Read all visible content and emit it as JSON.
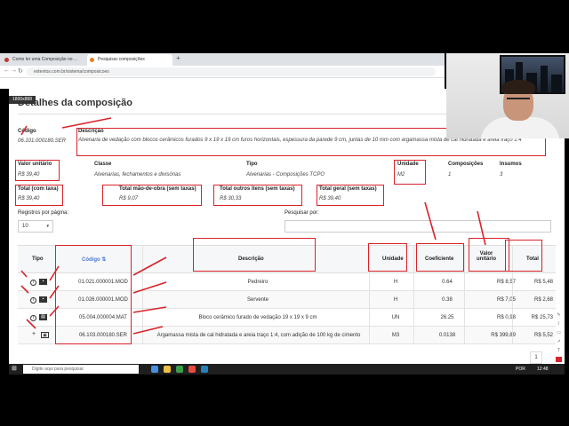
{
  "browser": {
    "tabs": [
      {
        "label": "Como ler uma Composição no ..."
      },
      {
        "label": "Pesquisar composições"
      }
    ],
    "new_tab": "+",
    "url": "extentos.com.br/sistema/composicoes",
    "resolution_badge": "1800x888"
  },
  "page": {
    "title": "Detalhes da composição",
    "codigo": {
      "label": "Código",
      "value": "06.101.000180.SER"
    },
    "descricao": {
      "label": "Descrição",
      "value": "Alvenaria de vedação com blocos cerâmicos furados 9 x 19 x 19 cm furos horizontais, espessura da parede 9 cm, juntas de 10 mm com argamassa mista de cal hidratada e areia traço 1:4"
    },
    "valor_unitario": {
      "label": "Valor unitário",
      "value": "R$ 39,40"
    },
    "classe": {
      "label": "Classe",
      "value": "Alvenarias, fechamentos e divisórias"
    },
    "tipo": {
      "label": "Tipo",
      "value": "Alvenarias - Composições TCPO"
    },
    "unidade": {
      "label": "Unidade",
      "value": "M2"
    },
    "composicoes": {
      "label": "Composições",
      "value": "1"
    },
    "insumos": {
      "label": "Insumos",
      "value": "3"
    },
    "total_com_taxa": {
      "label": "Total (com taxa)",
      "value": "R$ 39,40"
    },
    "total_mao_de_obra": {
      "label": "Total mão-de-obra (sem taxas)",
      "value": "R$ 9,07"
    },
    "total_outros": {
      "label": "Total outros itens (sem taxas)",
      "value": "R$ 30,33"
    },
    "total_geral": {
      "label": "Total geral (sem taxas)",
      "value": "R$ 39,40"
    },
    "registros_label": "Registros por página:",
    "registros_value": "10",
    "pesquisar_label": "Pesquisar por:"
  },
  "table": {
    "headers": {
      "tipo": "Tipo",
      "codigo": "Código",
      "descricao": "Descrição",
      "unidade": "Unidade",
      "coeficiente": "Coeficiente",
      "valor_unitario_1": "Valor",
      "valor_unitario_2": "unitário",
      "total": "Total"
    },
    "rows": [
      {
        "codigo": "01.021.000001.MOD",
        "descricao": "Pedreiro",
        "unidade": "H",
        "coeficiente": "0.64",
        "valor": "R$ 8,57",
        "total": "R$ 5,48",
        "icon": "worker-icon"
      },
      {
        "codigo": "01.026.000001.MOD",
        "descricao": "Servente",
        "unidade": "H",
        "coeficiente": "0.38",
        "valor": "R$ 7,05",
        "total": "R$ 2,68",
        "icon": "worker-icon"
      },
      {
        "codigo": "05.004.000004.MAT",
        "descricao": "Bloco cerâmico furado de vedação 19 x 19 x 9 cm",
        "unidade": "UN",
        "coeficiente": "26.25",
        "valor": "R$ 0,98",
        "total": "R$ 25,73",
        "icon": "material-icon"
      },
      {
        "codigo": "06.103.000180.SER",
        "descricao": "Argamassa mista de cal hidratada e areia traço 1:4, com adição de 100 kg de cimento",
        "unidade": "M3",
        "coeficiente": "0.0138",
        "valor": "R$ 399,89",
        "total": "R$ 5,52",
        "icon": "composition-icon"
      }
    ],
    "pager_current": "1"
  },
  "taskbar": {
    "search_placeholder": "Digite aqui para pesquisar",
    "lang": "POR",
    "time": "12:48"
  },
  "colors": {
    "annotation": "#d9232a",
    "code_link": "#4a7bd6"
  }
}
